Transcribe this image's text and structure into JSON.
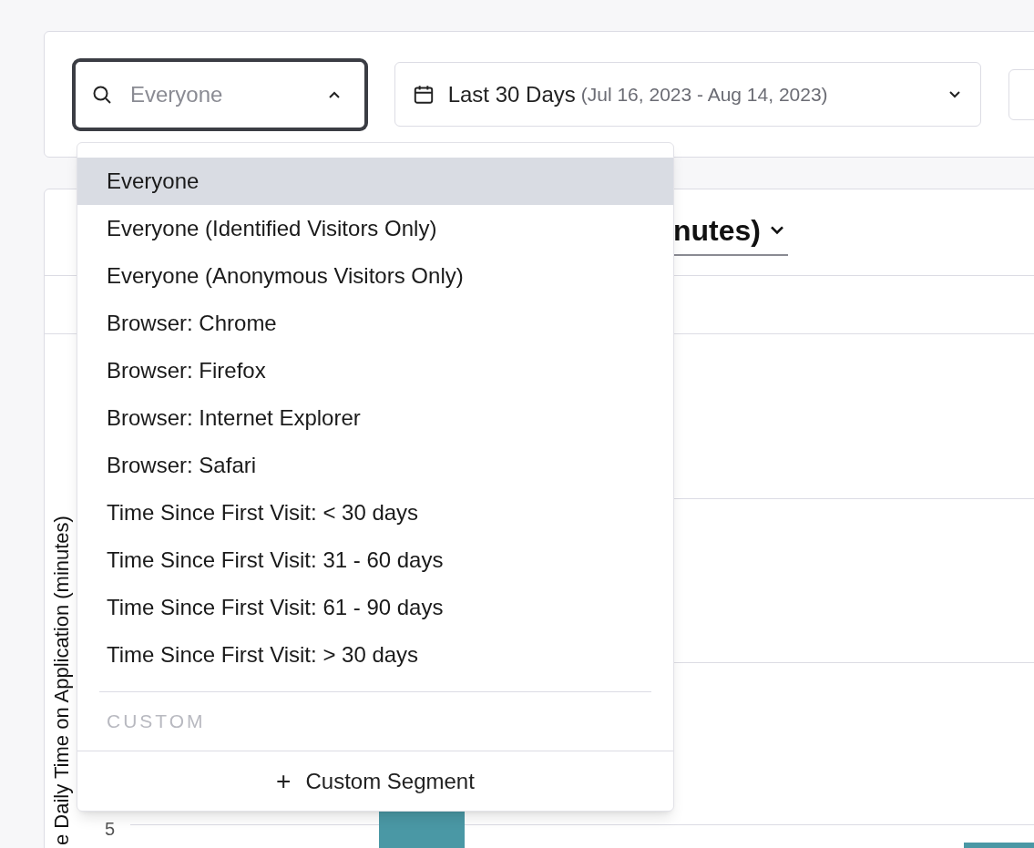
{
  "filters": {
    "segment_search": {
      "placeholder": "Everyone",
      "expanded": true
    },
    "date_range": {
      "label": "Last 30 Days",
      "range": "(Jul 16, 2023 - Aug 14, 2023)"
    }
  },
  "chart": {
    "title": "nutes)",
    "y_axis_label": "e Daily Time on Application (minutes)",
    "y_tick": "5"
  },
  "segment_menu": {
    "items": [
      {
        "label": "Everyone",
        "selected": true
      },
      {
        "label": "Everyone (Identified Visitors Only)",
        "selected": false
      },
      {
        "label": "Everyone (Anonymous Visitors Only)",
        "selected": false
      },
      {
        "label": "Browser: Chrome",
        "selected": false
      },
      {
        "label": "Browser: Firefox",
        "selected": false
      },
      {
        "label": "Browser: Internet Explorer",
        "selected": false
      },
      {
        "label": "Browser: Safari",
        "selected": false
      },
      {
        "label": "Time Since First Visit: < 30 days",
        "selected": false
      },
      {
        "label": "Time Since First Visit: 31 - 60 days",
        "selected": false
      },
      {
        "label": "Time Since First Visit: 61 - 90 days",
        "selected": false
      },
      {
        "label": "Time Since First Visit: > 30 days",
        "selected": false
      }
    ],
    "section_header": "CUSTOM",
    "add_button": {
      "icon": "+",
      "label": "Custom Segment"
    }
  }
}
